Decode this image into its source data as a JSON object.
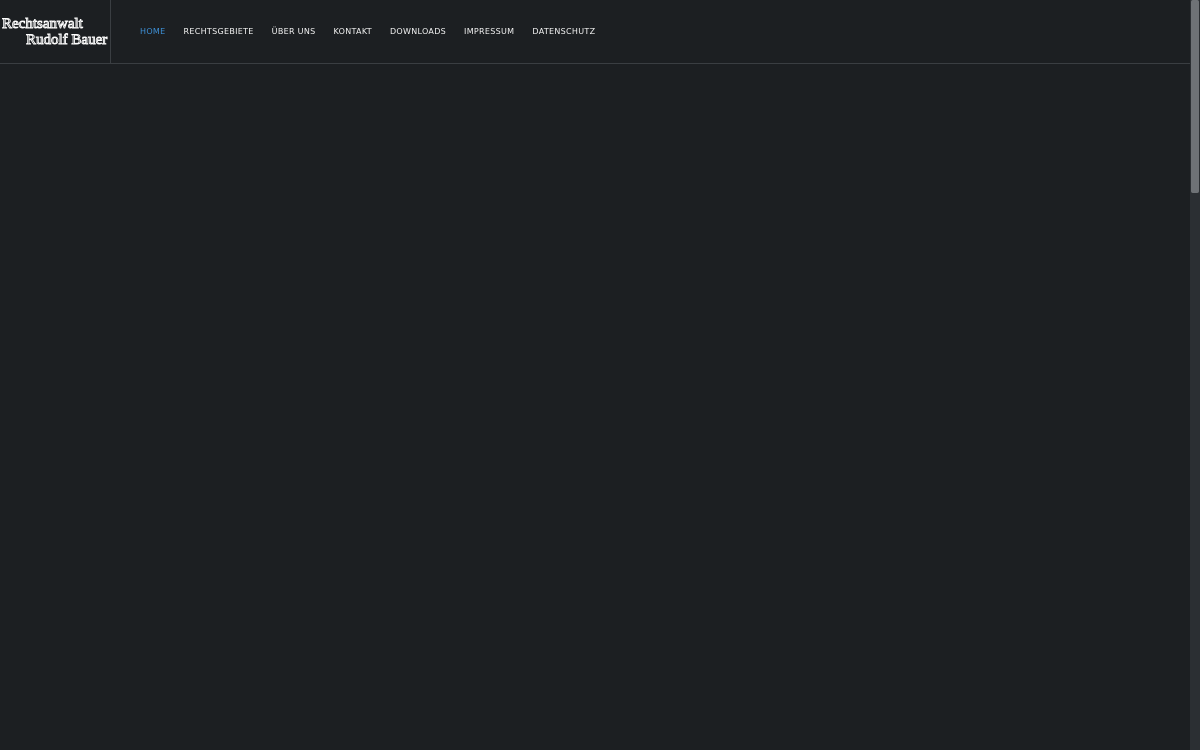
{
  "logo": {
    "line1": "Rechtsanwalt",
    "line2": "Rudolf Bauer"
  },
  "nav": {
    "items": [
      {
        "label": "HOME",
        "active": true
      },
      {
        "label": "RECHTSGEBIETE",
        "active": false
      },
      {
        "label": "ÜBER UNS",
        "active": false
      },
      {
        "label": "KONTAKT",
        "active": false
      },
      {
        "label": "DOWNLOADS",
        "active": false
      },
      {
        "label": "IMPRESSUM",
        "active": false
      },
      {
        "label": "DATENSCHUTZ",
        "active": false
      }
    ]
  },
  "colors": {
    "background": "#1c1f22",
    "accent": "#3d8fd6",
    "nav_text": "#f2f2f2",
    "divider": "#3a3e42"
  }
}
